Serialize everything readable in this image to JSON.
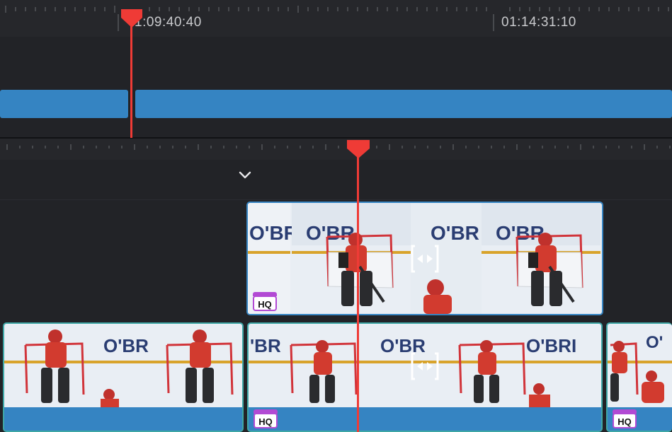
{
  "timeline": {
    "upper_ruler": {
      "timecode_left": "1:09:40:40",
      "timecode_right": "01:14:31:10"
    },
    "upper_track": {
      "clip_color": "#3584c2"
    },
    "lower_track": {
      "collapse_icon": "chevron-down-icon"
    },
    "clips": {
      "badge_label": "HQ",
      "badge_color": "#b24ad4",
      "selected_outline_color": "#3584c2",
      "clip_outline_color": "#3fa7a6"
    },
    "playhead_color": "#ef3b36",
    "background": "#1d1e22"
  }
}
